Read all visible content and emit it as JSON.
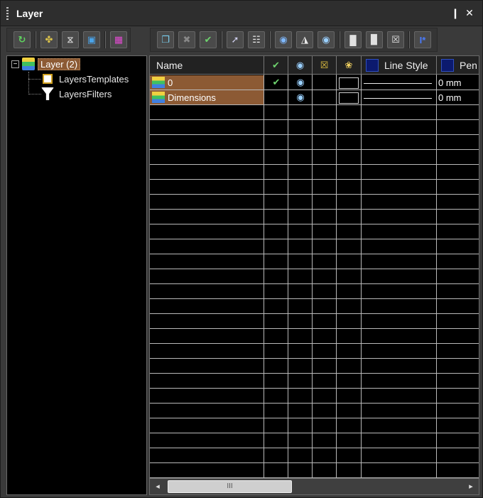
{
  "window": {
    "title": "Layer",
    "pin_glyph": "❙",
    "close_glyph": "✕"
  },
  "toolbar_left": [
    {
      "name": "refresh-icon",
      "glyph": "↻",
      "color": "#5fd35f"
    },
    {
      "name": "new-template-icon",
      "glyph": "✤",
      "color": "#d8c04a"
    },
    {
      "name": "new-filter-icon",
      "glyph": "⧖",
      "color": "#c8c8c8"
    },
    {
      "name": "layer-properties-icon",
      "glyph": "▣",
      "color": "#4aa3e8"
    },
    {
      "name": "layer-states-icon",
      "glyph": "▦",
      "color": "#e04ad0"
    }
  ],
  "toolbar_right": [
    {
      "name": "new-layer-icon",
      "glyph": "❐",
      "color": "#7ad0f0"
    },
    {
      "name": "delete-layer-icon",
      "glyph": "✖",
      "color": "#888888"
    },
    {
      "name": "set-current-icon",
      "glyph": "✔",
      "color": "#6ed36e"
    },
    {
      "name": "select-objects-icon",
      "glyph": "➚",
      "color": "#d0d0f0"
    },
    {
      "name": "layer-settings-icon",
      "glyph": "☷",
      "color": "#e8e8e8"
    },
    {
      "name": "show-all-icon",
      "glyph": "◉",
      "color": "#7fb8ff"
    },
    {
      "name": "isolate-icon",
      "glyph": "◮",
      "color": "#e8e8e8"
    },
    {
      "name": "visibility-icon",
      "glyph": "◉",
      "color": "#9ad0ff"
    },
    {
      "name": "unlock-icon",
      "glyph": "█",
      "color": "#e0e0e0"
    },
    {
      "name": "lock-partial-icon",
      "glyph": "▉",
      "color": "#e0e0e0"
    },
    {
      "name": "lock-icon",
      "glyph": "☒",
      "color": "#e0e0e0"
    },
    {
      "name": "text-layer-icon",
      "glyph": "I*",
      "color": "#4a7cff"
    }
  ],
  "tree": {
    "root": {
      "label": "Layer (2)",
      "expander": "−"
    },
    "children": [
      {
        "label": "LayersTemplates"
      },
      {
        "label": "LayersFilters"
      }
    ]
  },
  "grid": {
    "headers": {
      "name": "Name",
      "current_icon": "✔",
      "visible_icon": "◉",
      "lock_icon": "☒",
      "color_icon": "❀",
      "linestyle": "Line Style",
      "pen": "Pen"
    },
    "rows": [
      {
        "name": "0",
        "current": "✔",
        "visible": "◉",
        "pen": "0 mm"
      },
      {
        "name": "Dimensions",
        "current": "",
        "visible": "◉",
        "pen": "0 mm"
      }
    ]
  },
  "scrollbar": {
    "left_arrow": "◂",
    "right_arrow": "▸",
    "thumb_grip": "III"
  },
  "colors": {
    "selection": "#8c5a34",
    "grid_lines": "#b9b9b9",
    "background": "#000000"
  }
}
